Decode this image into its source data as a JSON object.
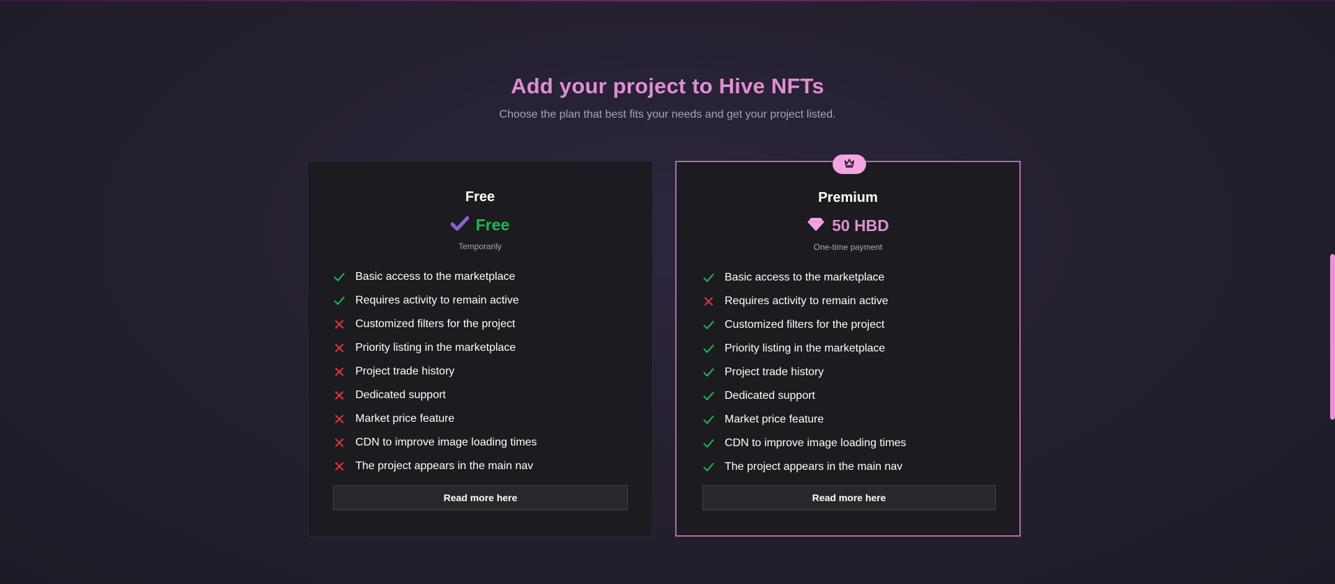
{
  "header": {
    "title": "Add your project to Hive NFTs",
    "subtitle": "Choose the plan that best fits your needs and get your project listed."
  },
  "plans": [
    {
      "name": "Free",
      "price": "Free",
      "price_icon": "check-icon",
      "price_note": "Temporarily",
      "cta": "Read more here",
      "features": [
        {
          "label": "Basic access to the marketplace",
          "included": true
        },
        {
          "label": "Requires activity to remain active",
          "included": true
        },
        {
          "label": "Customized filters for the project",
          "included": false
        },
        {
          "label": "Priority listing in the marketplace",
          "included": false
        },
        {
          "label": "Project trade history",
          "included": false
        },
        {
          "label": "Dedicated support",
          "included": false
        },
        {
          "label": "Market price feature",
          "included": false
        },
        {
          "label": "CDN to improve image loading times",
          "included": false
        },
        {
          "label": "The project appears in the main nav",
          "included": false
        }
      ]
    },
    {
      "name": "Premium",
      "price": "50 HBD",
      "price_icon": "diamond-icon",
      "badge_icon": "crown-icon",
      "price_note": "One-time payment",
      "cta": "Read more here",
      "features": [
        {
          "label": "Basic access to the marketplace",
          "included": true
        },
        {
          "label": "Requires activity to remain active",
          "included": false
        },
        {
          "label": "Customized filters for the project",
          "included": true
        },
        {
          "label": "Priority listing in the marketplace",
          "included": true
        },
        {
          "label": "Project trade history",
          "included": true
        },
        {
          "label": "Dedicated support",
          "included": true
        },
        {
          "label": "Market price feature",
          "included": true
        },
        {
          "label": "CDN to improve image loading times",
          "included": true
        },
        {
          "label": "The project appears in the main nav",
          "included": true
        }
      ]
    }
  ],
  "colors": {
    "accent": "#dd8fd2",
    "included": "#1db954",
    "excluded": "#e5333f",
    "free_check": "#8a63d2"
  }
}
